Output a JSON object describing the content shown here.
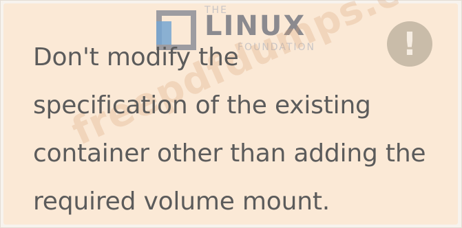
{
  "message": {
    "line1": "Don't modify the",
    "line2": "specification of the existing",
    "line3": "container other than adding the",
    "line4": "required volume mount."
  },
  "alert_icon": {
    "name": "exclamation-icon",
    "glyph": "!",
    "color": "#c9bca9"
  },
  "logo": {
    "the": "THE",
    "word": "LINUX",
    "sub": "FOUNDATION"
  },
  "watermark": {
    "text": "freepdfdumps.com"
  },
  "colors": {
    "panel_background": "#fbe9d6",
    "text": "#5b5b5b"
  }
}
